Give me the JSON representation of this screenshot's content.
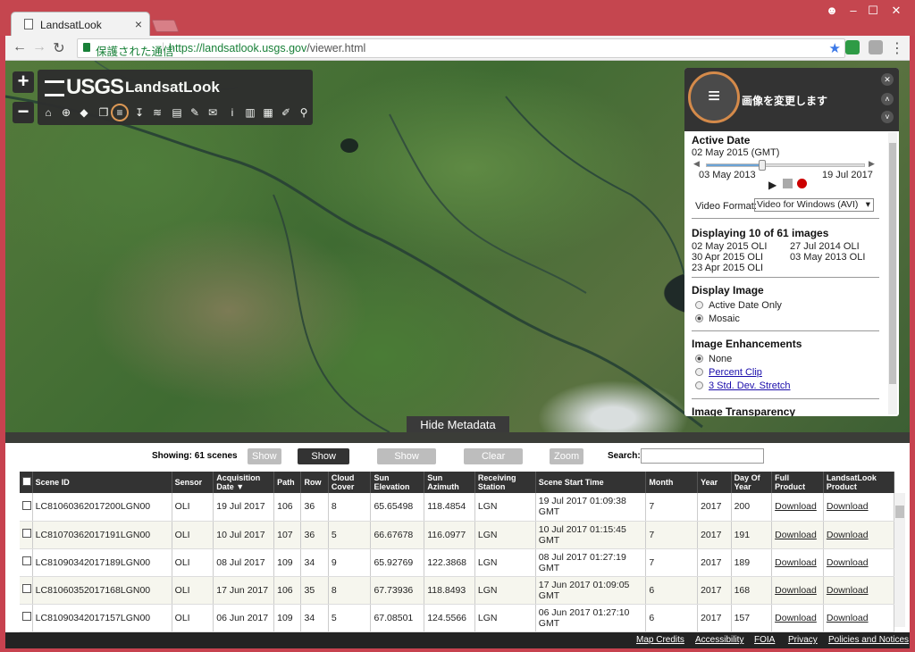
{
  "browser": {
    "tab_title": "LandsatLook",
    "secure_label": "保護された通信",
    "url_base": "https://landsatlook.usgs.gov",
    "url_path": "/viewer.html"
  },
  "map": {
    "zoom_in": "+",
    "zoom_out": "−",
    "logo_text": "USGS",
    "app_title": "LandsatLook",
    "tools": [
      "home-icon",
      "crosshair-icon",
      "tag-icon",
      "layers-copy-icon",
      "adjust-sliders-icon",
      "download-arrow-icon",
      "stack-icon",
      "print-icon",
      "pencil-icon",
      "chat-icon",
      "info-icon",
      "book-icon",
      "bookmark-icon",
      "edit-icon",
      "search-icon"
    ]
  },
  "panel": {
    "title": "画像を変更します",
    "active_date_heading": "Active Date",
    "active_date": "02 May 2015 (GMT)",
    "range_start": "03 May 2013",
    "range_end": "19 Jul 2017",
    "video_format_label": "Video Format:",
    "video_format_value": "Video for Windows (AVI)",
    "displaying_heading": "Displaying 10 of 61 images",
    "images_col1": [
      "02 May 2015 OLI",
      "30 Apr 2015 OLI",
      "23 Apr 2015 OLI"
    ],
    "images_col2": [
      "27 Jul 2014 OLI",
      "03 May 2013 OLI"
    ],
    "display_image_heading": "Display Image",
    "display_options": [
      "Active Date Only",
      "Mosaic"
    ],
    "enhancements_heading": "Image Enhancements",
    "enhancement_none": "None",
    "enhancement_links": [
      "Percent Clip",
      "3 Std. Dev. Stretch"
    ],
    "transparency_heading": "Image Transparency"
  },
  "meta": {
    "hide_label": "Hide Metadata",
    "showing": "Showing: 61 scenes",
    "buttons": [
      "Show All",
      "Show Displayed",
      "Show Footprint(s)",
      "Clear Footprint(s)",
      "Zoom To"
    ],
    "search_label": "Search:",
    "columns": [
      "Scene ID",
      "Sensor",
      "Acquisition Date",
      "Path",
      "Row",
      "Cloud Cover",
      "Sun Elevation",
      "Sun Azimuth",
      "Receiving Station",
      "Scene Start Time",
      "Month",
      "Year",
      "Day Of Year",
      "Full Product",
      "LandsatLook Product"
    ],
    "sort_indicator": "▼",
    "rows": [
      [
        "LC81060362017200LGN00",
        "OLI",
        "19 Jul 2017",
        "106",
        "36",
        "8",
        "65.65498",
        "118.4854",
        "LGN",
        "19 Jul 2017 01:09:38 GMT",
        "7",
        "2017",
        "200",
        "Download",
        "Download"
      ],
      [
        "LC81070362017191LGN00",
        "OLI",
        "10 Jul 2017",
        "107",
        "36",
        "5",
        "66.67678",
        "116.0977",
        "LGN",
        "10 Jul 2017 01:15:45 GMT",
        "7",
        "2017",
        "191",
        "Download",
        "Download"
      ],
      [
        "LC81090342017189LGN00",
        "OLI",
        "08 Jul 2017",
        "109",
        "34",
        "9",
        "65.92769",
        "122.3868",
        "LGN",
        "08 Jul 2017 01:27:19 GMT",
        "7",
        "2017",
        "189",
        "Download",
        "Download"
      ],
      [
        "LC81060352017168LGN00",
        "OLI",
        "17 Jun 2017",
        "106",
        "35",
        "8",
        "67.73936",
        "118.8493",
        "LGN",
        "17 Jun 2017 01:09:05 GMT",
        "6",
        "2017",
        "168",
        "Download",
        "Download"
      ],
      [
        "LC81090342017157LGN00",
        "OLI",
        "06 Jun 2017",
        "109",
        "34",
        "5",
        "67.08501",
        "124.5566",
        "LGN",
        "06 Jun 2017 01:27:10 GMT",
        "6",
        "2017",
        "157",
        "Download",
        "Download"
      ]
    ]
  },
  "footer": [
    "Map Credits",
    "Accessibility",
    "FOIA",
    "Privacy",
    "Policies and Notices"
  ]
}
